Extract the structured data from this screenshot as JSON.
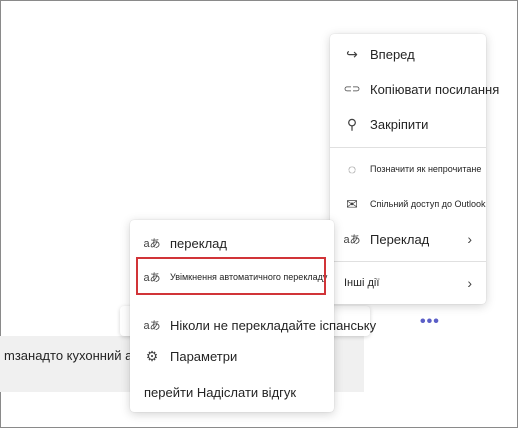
{
  "chat": {
    "message_text": "mзанадто кухонний акуум",
    "more_options": "•••"
  },
  "main_menu": {
    "items": [
      {
        "label": "Вперед",
        "icon": "forward-arrow-icon",
        "glyph": "↪"
      },
      {
        "label": "Копіювати посилання",
        "icon": "link-icon",
        "glyph": "⊂⊃"
      },
      {
        "label": "Закріпити",
        "icon": "pin-icon",
        "glyph": "⚲"
      },
      {
        "label": "Позначити як непрочитане",
        "icon": "mark-unread-icon",
        "glyph": "◌"
      },
      {
        "label": "Спільний доступ до Outlook",
        "icon": "mail-icon",
        "glyph": "✉"
      },
      {
        "label": "Переклад",
        "icon": "translate-icon",
        "glyph": "aあ"
      },
      {
        "label": "Інші дії",
        "icon": "",
        "glyph": ""
      }
    ],
    "chevron": "›"
  },
  "sub_menu": {
    "items": [
      {
        "label": "переклад",
        "icon": "translate-icon",
        "glyph": "aあ"
      },
      {
        "label": "Увімкнення автоматичного перекладу",
        "icon": "auto-translate-icon",
        "glyph": "aあ"
      },
      {
        "label": "Ніколи не перекладайте іспанську",
        "icon": "translate-off-icon",
        "glyph": "aあ"
      },
      {
        "label": "Параметри",
        "icon": "settings-icon",
        "glyph": "⚙"
      },
      {
        "label": "перейти Надіслати відгук",
        "icon": "",
        "glyph": ""
      }
    ]
  },
  "colors": {
    "highlight_border": "#d13438",
    "accent": "#5b5fc7"
  }
}
